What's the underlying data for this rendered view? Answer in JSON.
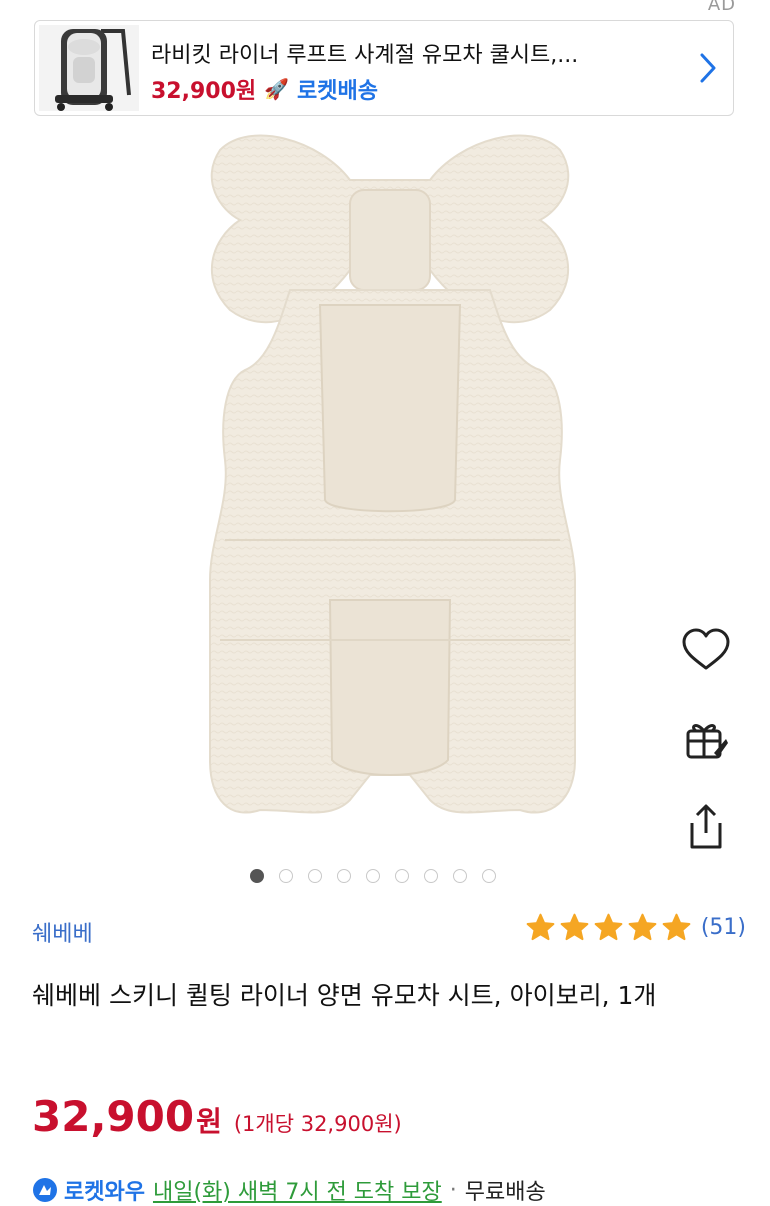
{
  "ad": {
    "label": "AD",
    "title": "라비킷 라이너 루프트 사계절 유모차 쿨시트,...",
    "price": "32,900원",
    "delivery_badge": "로켓배송",
    "thumbnail": "stroller-seat-liner-thumbnail"
  },
  "product": {
    "image": "ivory-quilted-stroller-liner",
    "gallery": {
      "total": 9,
      "active_index": 0
    },
    "brand": "쉐베베",
    "rating": {
      "stars": 5,
      "count": "(51)"
    },
    "title": "쉐베베 스키니 퀼팅 라이너 양면 유모차 시트, 아이보리, 1개",
    "price": "32,900",
    "price_unit": "원",
    "unit_price": "(1개당 32,900원)"
  },
  "actions": [
    {
      "name": "wishlist",
      "icon": "heart-icon"
    },
    {
      "name": "gift",
      "icon": "gift-rocket-icon"
    },
    {
      "name": "share",
      "icon": "share-icon"
    }
  ],
  "delivery": {
    "badge": "로켓와우",
    "date": "내일(화) 새벽 7시 전 도착 보장",
    "separator": "·",
    "shipping": "무료배송"
  },
  "colors": {
    "price_red": "#c8102e",
    "brand_blue": "#3a6ec9",
    "rocket_blue": "#1f73e6",
    "star_gold": "#f5a623",
    "delivery_green": "#2e9b3a"
  }
}
